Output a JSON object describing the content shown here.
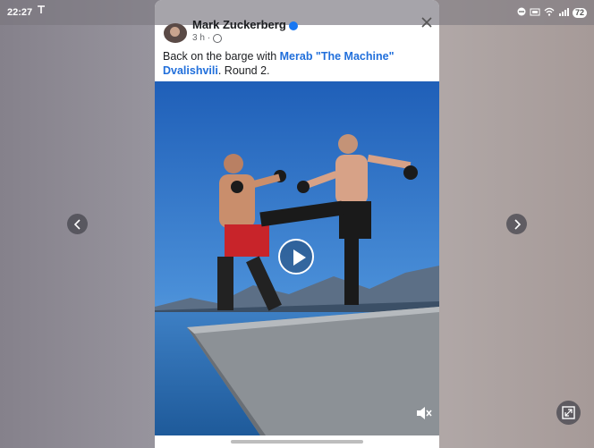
{
  "status_bar": {
    "time": "22:27",
    "battery": "72"
  },
  "post": {
    "author": "Mark Zuckerberg",
    "timestamp": "3 h",
    "caption_prefix": "Back on the barge with ",
    "mention": "Merab \"The Machine\" Dvalishvili",
    "caption_suffix": ". Round 2."
  },
  "colors": {
    "mention": "#216fdb",
    "verified": "#1877f2"
  },
  "icons": {
    "close": "close-icon",
    "play": "play-icon",
    "mute": "mute-icon",
    "prev": "chevron-left-icon",
    "next": "chevron-right-icon",
    "fullscreen": "fullscreen-icon"
  }
}
